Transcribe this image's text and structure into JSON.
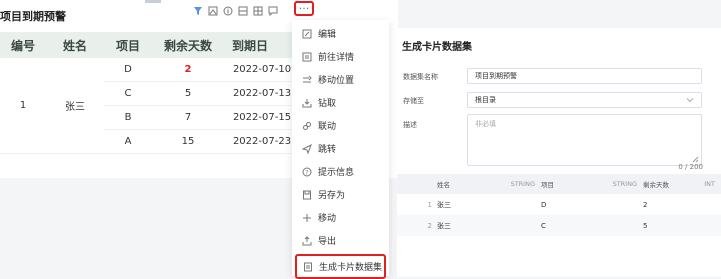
{
  "card": {
    "title": "项目到期预警",
    "columns": [
      "编号",
      "姓名",
      "项目",
      "剩余天数",
      "到期日"
    ],
    "group": {
      "id": "1",
      "name": "张三"
    },
    "rows": [
      {
        "project": "D",
        "days": "2",
        "date": "2022-07-10"
      },
      {
        "project": "C",
        "days": "5",
        "date": "2022-07-13"
      },
      {
        "project": "B",
        "days": "7",
        "date": "2022-07-15"
      },
      {
        "project": "A",
        "days": "15",
        "date": "2022-07-23"
      }
    ],
    "more_label": "···"
  },
  "menu": {
    "items": [
      {
        "label": "编辑",
        "icon": "edit-icon"
      },
      {
        "label": "前往详情",
        "icon": "detail-icon"
      },
      {
        "label": "移动位置",
        "icon": "move-position-icon"
      },
      {
        "label": "钻取",
        "icon": "drill-icon"
      },
      {
        "label": "联动",
        "icon": "link-icon"
      },
      {
        "label": "跳转",
        "icon": "jump-icon"
      },
      {
        "label": "提示信息",
        "icon": "tooltip-icon"
      },
      {
        "label": "另存为",
        "icon": "save-as-icon"
      },
      {
        "label": "移动",
        "icon": "move-icon"
      },
      {
        "label": "导出",
        "icon": "export-icon"
      },
      {
        "label": "生成卡片数据集",
        "icon": "dataset-icon"
      }
    ]
  },
  "dialog": {
    "title": "生成卡片数据集",
    "name_label": "数据集名称",
    "name_value": "项目到期预警",
    "store_label": "存储至",
    "store_value": "根目录",
    "desc_label": "描述",
    "desc_placeholder": "非必填",
    "counter": "0 / 200",
    "preview": {
      "columns": [
        {
          "name": "姓名",
          "type": "STRING"
        },
        {
          "name": "项目",
          "type": "STRING"
        },
        {
          "name": "剩余天数",
          "type": "INT"
        }
      ],
      "rows": [
        {
          "idx": "1",
          "name": "张三",
          "project": "D",
          "days": "2"
        },
        {
          "idx": "2",
          "name": "张三",
          "project": "C",
          "days": "5"
        }
      ]
    }
  },
  "colors": {
    "accent_red": "#e02020",
    "header_bg": "#e9f0ec"
  }
}
